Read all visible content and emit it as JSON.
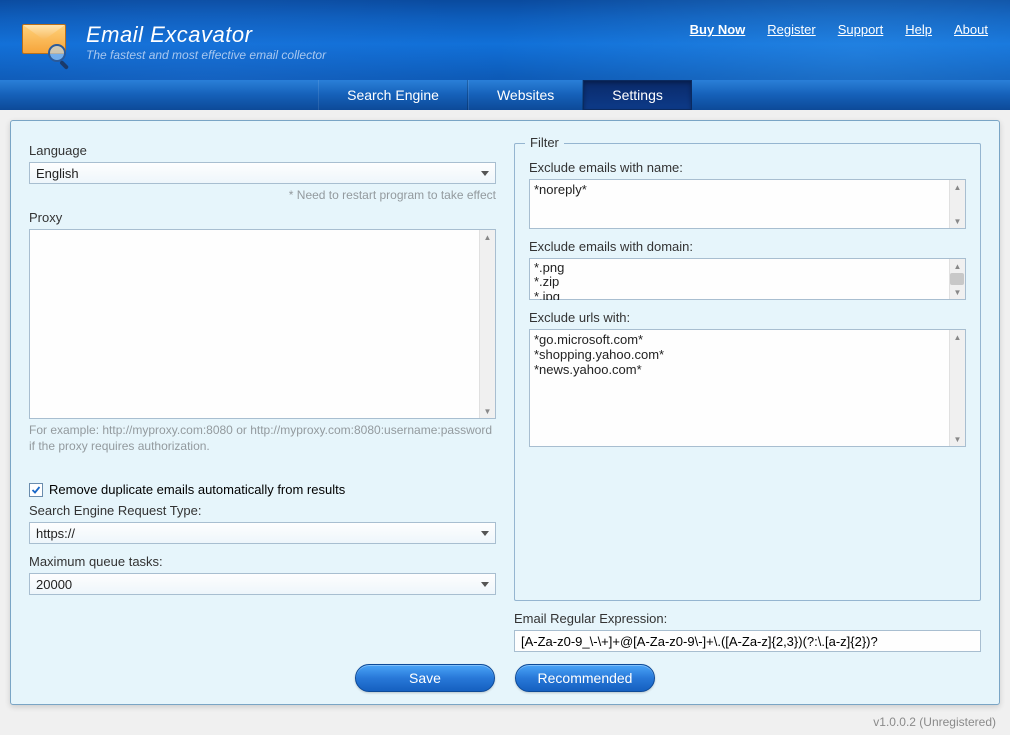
{
  "app": {
    "title": "Email Excavator",
    "tagline": "The fastest and most effective email collector"
  },
  "topnav": {
    "buy": "Buy Now",
    "register": "Register",
    "support": "Support",
    "help": "Help",
    "about": "About"
  },
  "tabs": {
    "search": "Search Engine",
    "websites": "Websites",
    "settings": "Settings"
  },
  "left": {
    "language_label": "Language",
    "language_value": "English",
    "language_hint": "* Need to restart program to take effect",
    "proxy_label": "Proxy",
    "proxy_value": "",
    "proxy_hint": "For example: http://myproxy.com:8080 or http://myproxy.com:8080:username:password if the proxy requires authorization.",
    "dup_label": "Remove duplicate emails automatically from results",
    "reqtype_label": "Search Engine Request Type:",
    "reqtype_value": "https://",
    "queue_label": "Maximum queue tasks:",
    "queue_value": "20000"
  },
  "filter": {
    "legend": "Filter",
    "ex_name_label": "Exclude emails with name:",
    "ex_name_value": "*noreply*",
    "ex_domain_label": "Exclude emails with domain:",
    "ex_domain_value": "*.png\n*.zip\n*.jpg",
    "ex_url_label": "Exclude urls with:",
    "ex_url_value": "*go.microsoft.com*\n*shopping.yahoo.com*\n*news.yahoo.com*"
  },
  "regex": {
    "label": "Email Regular Expression:",
    "value": "[A-Za-z0-9_\\-\\+]+@[A-Za-z0-9\\-]+\\.([A-Za-z]{2,3})(?:\\.[a-z]{2})?"
  },
  "buttons": {
    "save": "Save",
    "recommended": "Recommended"
  },
  "footer": "v1.0.0.2 (Unregistered)"
}
